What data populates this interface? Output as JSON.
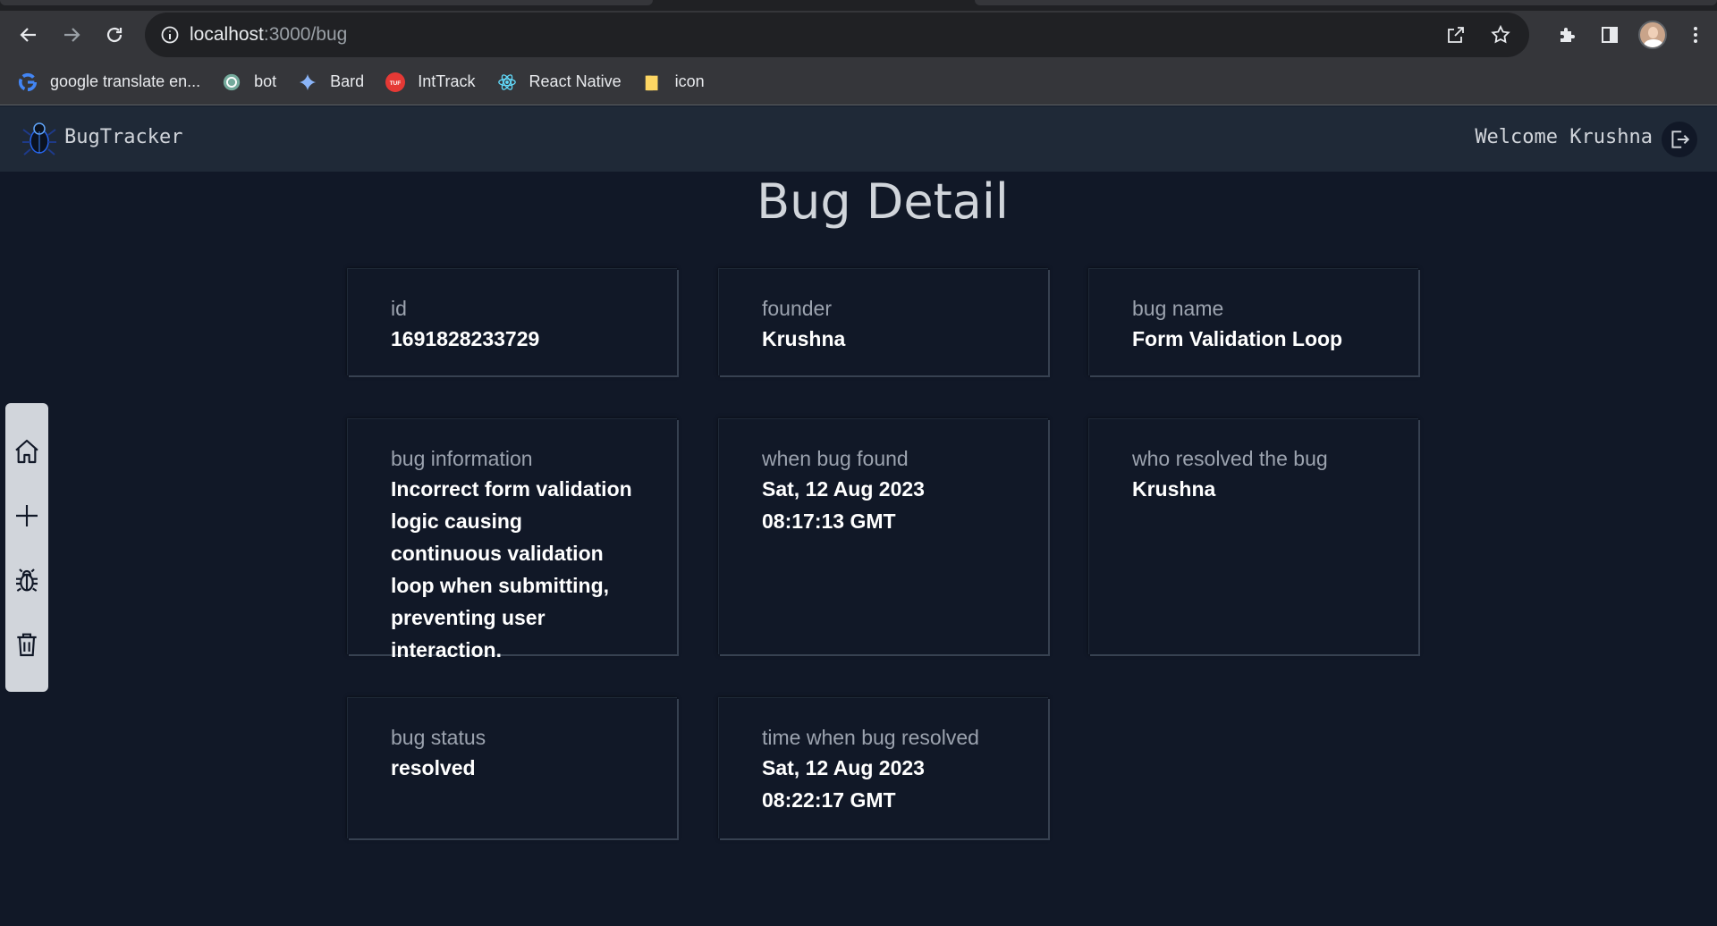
{
  "browser": {
    "url_host": "localhost",
    "url_path": ":3000/bug",
    "bookmarks": [
      {
        "label": "google translate en...",
        "icon": "google-icon",
        "color": "#4285f4"
      },
      {
        "label": "bot",
        "icon": "openai-icon",
        "color": "#74aa9c"
      },
      {
        "label": "Bard",
        "icon": "bard-sparkle-icon",
        "color": "#8ab4f8"
      },
      {
        "label": "IntTrack",
        "icon": "tuf-icon",
        "color": "#e53935"
      },
      {
        "label": "React Native",
        "icon": "react-icon",
        "color": "#61dafb"
      },
      {
        "label": "icon",
        "icon": "folder-icon",
        "color": "#fdd663"
      }
    ]
  },
  "header": {
    "brand": "BugTracker",
    "welcome": "Welcome Krushna"
  },
  "dock": {
    "items": [
      "home-icon",
      "plus-icon",
      "bug-icon",
      "trash-icon"
    ]
  },
  "page": {
    "title": "Bug Detail",
    "cards": [
      {
        "label": "id",
        "value": "1691828233729"
      },
      {
        "label": "founder",
        "value": "Krushna"
      },
      {
        "label": "bug name",
        "value": "Form Validation Loop"
      },
      {
        "label": "bug information",
        "value": "Incorrect form validation logic causing continuous validation loop when submitting, preventing user interaction."
      },
      {
        "label": "when bug found",
        "value": "Sat, 12 Aug 2023 08:17:13 GMT"
      },
      {
        "label": "who resolved the bug",
        "value": "Krushna"
      },
      {
        "label": "bug status",
        "value": "resolved"
      },
      {
        "label": "time when bug resolved",
        "value": "Sat, 12 Aug 2023 08:22:17 GMT"
      }
    ]
  },
  "colors": {
    "background": "#111827",
    "header": "#1f2937",
    "dock": "#d1d5db"
  }
}
